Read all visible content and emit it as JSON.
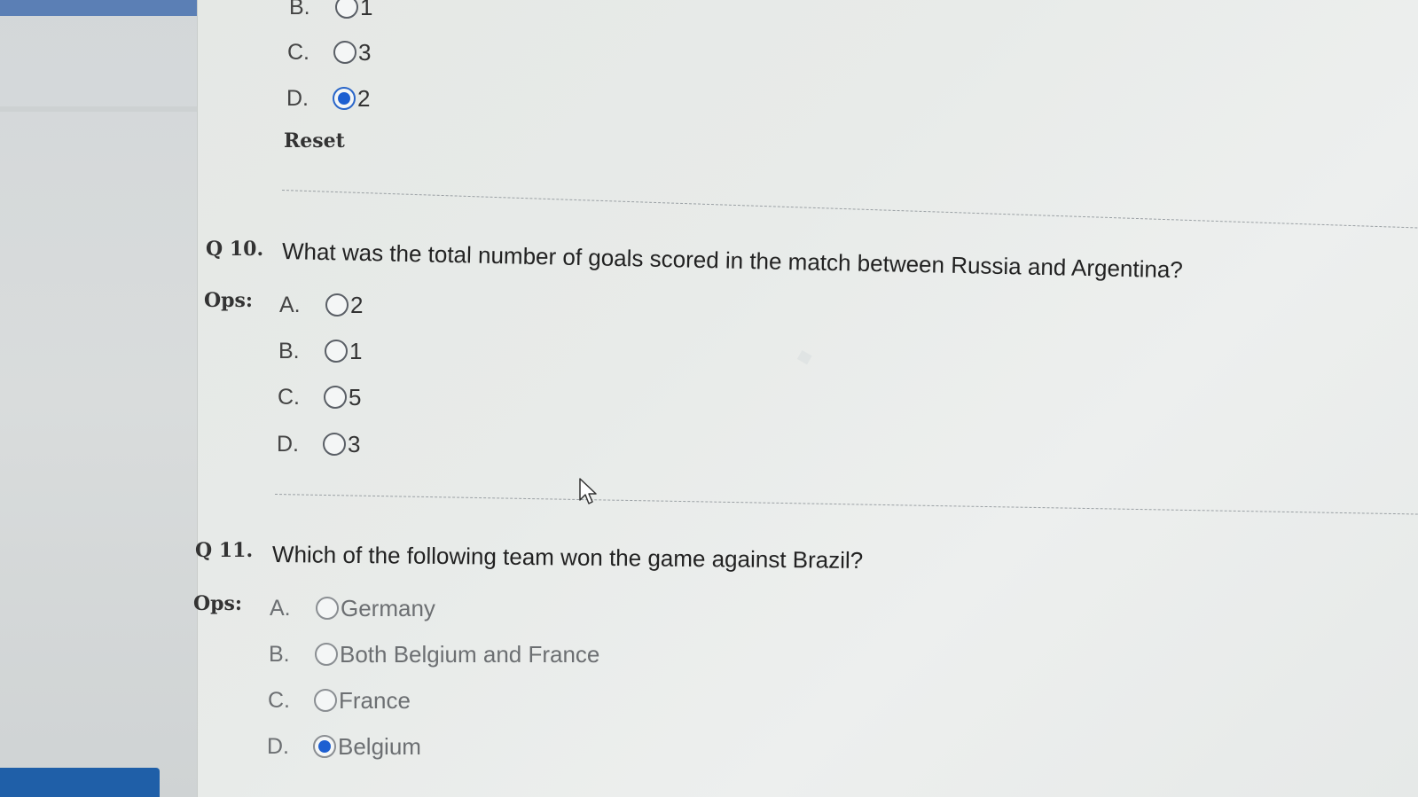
{
  "q9": {
    "options": [
      {
        "letter": "B.",
        "text": "1",
        "selected": false
      },
      {
        "letter": "C.",
        "text": "3",
        "selected": false
      },
      {
        "letter": "D.",
        "text": "2",
        "selected": true
      }
    ],
    "reset_label": "Reset"
  },
  "q10": {
    "number": "Q 10.",
    "question": "What was the total number of goals scored in the match between Russia and Argentina?",
    "ops_label": "Ops:",
    "options": [
      {
        "letter": "A.",
        "text": "2",
        "selected": false
      },
      {
        "letter": "B.",
        "text": "1",
        "selected": false
      },
      {
        "letter": "C.",
        "text": "5",
        "selected": false
      },
      {
        "letter": "D.",
        "text": "3",
        "selected": false
      }
    ]
  },
  "q11": {
    "number": "Q 11.",
    "question": "Which of the following team won the game against Brazil?",
    "ops_label": "Ops:",
    "options": [
      {
        "letter": "A.",
        "text": "Germany",
        "selected": false
      },
      {
        "letter": "B.",
        "text": "Both Belgium and France",
        "selected": false
      },
      {
        "letter": "C.",
        "text": "France",
        "selected": false
      },
      {
        "letter": "D.",
        "text": "Belgium",
        "selected": true
      }
    ]
  },
  "colors": {
    "accent": "#1d5fd1",
    "sidebar_button": "#1f5fa8"
  }
}
